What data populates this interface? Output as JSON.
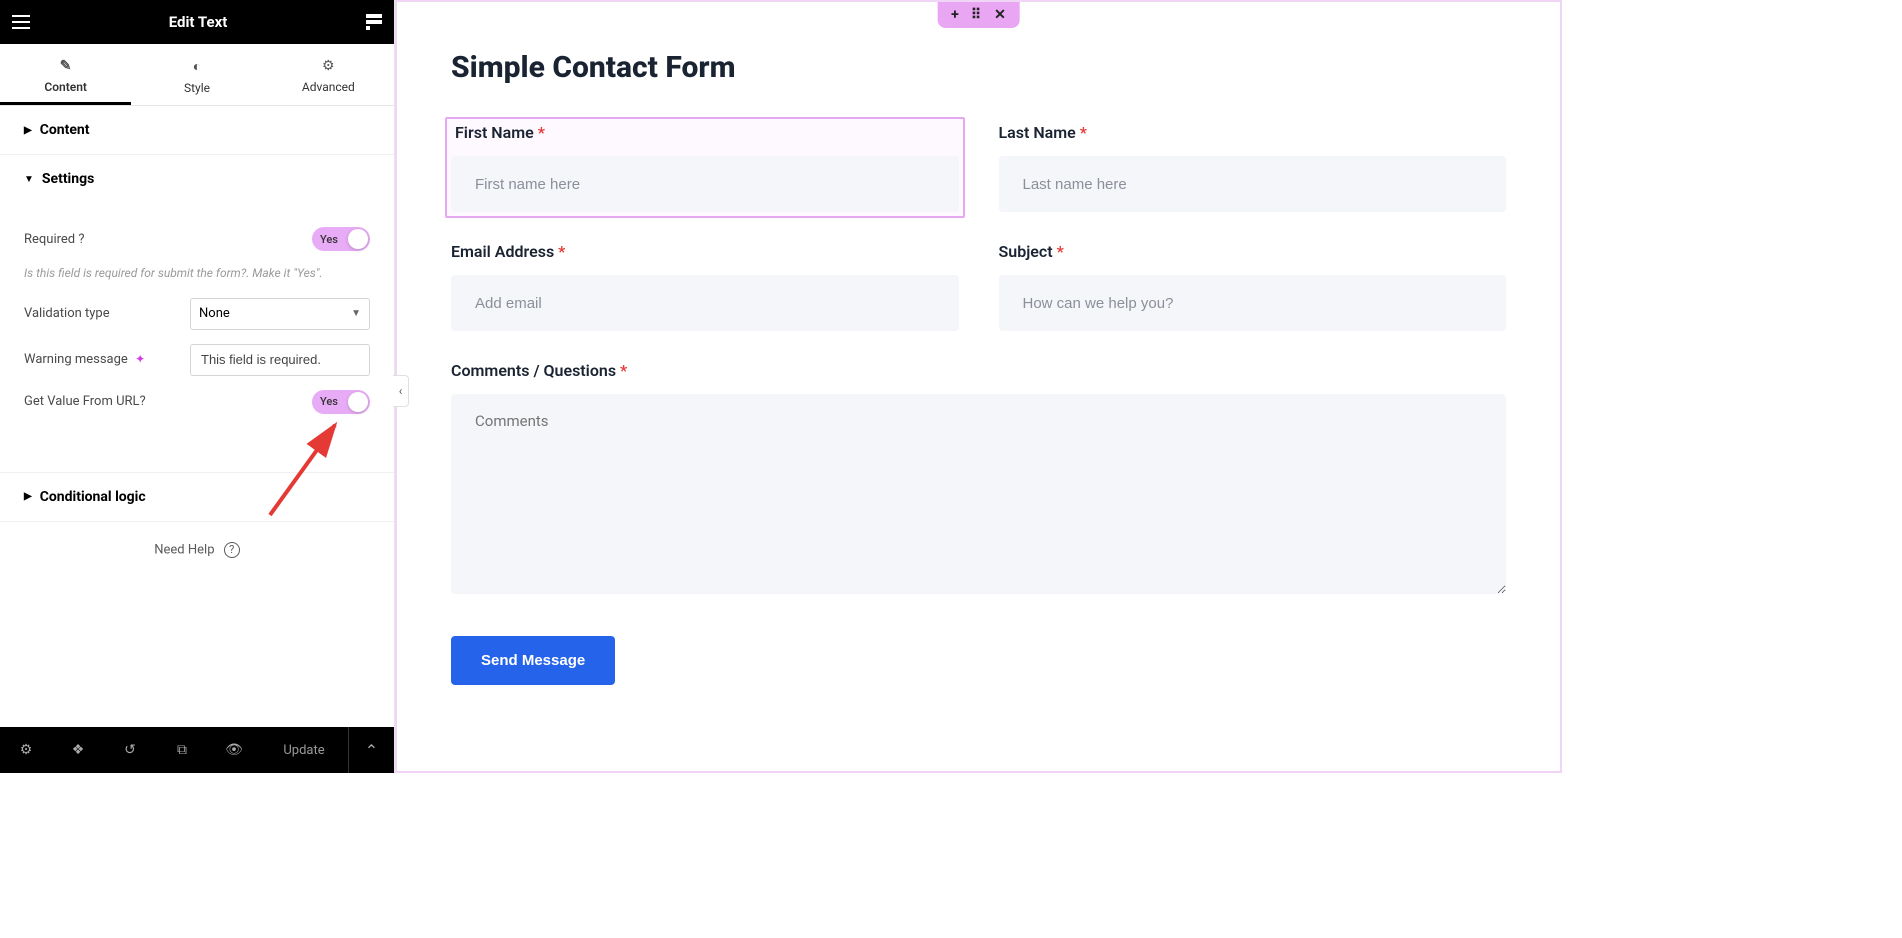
{
  "header": {
    "title": "Edit Text"
  },
  "tabs": {
    "content": "Content",
    "style": "Style",
    "advanced": "Advanced"
  },
  "sections": {
    "content": "Content",
    "settings": "Settings",
    "conditional": "Conditional logic"
  },
  "settings": {
    "required_label": "Required ?",
    "required_value": "Yes",
    "required_help": "Is this field is required for submit the form?. Make it \"Yes\".",
    "validation_label": "Validation type",
    "validation_value": "None",
    "warning_label": "Warning message",
    "warning_value": "This field is required.",
    "url_label": "Get Value From URL?",
    "url_value": "Yes"
  },
  "help": {
    "label": "Need Help"
  },
  "footer": {
    "update": "Update"
  },
  "form": {
    "title": "Simple Contact Form",
    "first_name_label": "First Name",
    "first_name_ph": "First name here",
    "last_name_label": "Last Name",
    "last_name_ph": "Last name here",
    "email_label": "Email Address",
    "email_ph": "Add email",
    "subject_label": "Subject",
    "subject_ph": "How can we help you?",
    "comments_label": "Comments / Questions",
    "comments_ph": "Comments",
    "submit": "Send Message"
  }
}
